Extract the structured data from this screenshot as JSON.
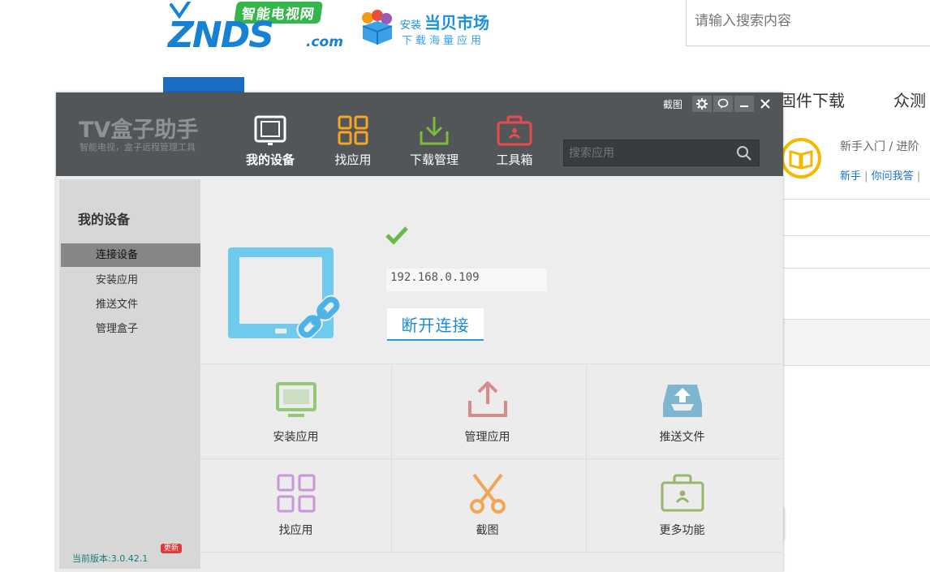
{
  "site": {
    "logo_badge": "智能电视网",
    "logo_main": "ZNDS",
    "logo_com": ".com",
    "market_install": "安装",
    "market_title": "当贝市场",
    "market_sub": "下载海量应用",
    "search_placeholder": "请输入搜索内容",
    "nav": [
      "固件下载",
      "众测"
    ],
    "help_text": "新手入门 / 进阶",
    "help_links": [
      "新手",
      "你问我答"
    ]
  },
  "app": {
    "brand": "TV盒子助手",
    "brand_sub": "智能电视，盒子远程管理工具",
    "screenshot_label": "截图",
    "top_nav": [
      {
        "label": "我的设备",
        "icon": "tv-icon",
        "color": "#ffffff"
      },
      {
        "label": "找应用",
        "icon": "grid-icon",
        "color": "#f5a623"
      },
      {
        "label": "下载管理",
        "icon": "download-icon",
        "color": "#7dbb38"
      },
      {
        "label": "工具箱",
        "icon": "toolbox-icon",
        "color": "#e94b4b"
      }
    ],
    "search_placeholder": "搜索应用",
    "sidebar": {
      "title": "我的设备",
      "items": [
        "连接设备",
        "安装应用",
        "推送文件",
        "管理盒子"
      ],
      "active_index": 0,
      "version": "当前版本:3.0.42.1",
      "update_badge": "更新"
    },
    "device": {
      "ip": "192.168.0.109",
      "disconnect_label": "断开连接",
      "connected": true
    },
    "tiles": [
      {
        "label": "安装应用",
        "icon": "install-tv-icon",
        "color": "#93c87a"
      },
      {
        "label": "管理应用",
        "icon": "upload-tray-icon",
        "color": "#d98b8b"
      },
      {
        "label": "推送文件",
        "icon": "push-box-icon",
        "color": "#7fb6cf"
      },
      {
        "label": "找应用",
        "icon": "grid-icon",
        "color": "#c996d9"
      },
      {
        "label": "截图",
        "icon": "scissors-icon",
        "color": "#f2a555"
      },
      {
        "label": "更多功能",
        "icon": "toolbox-icon",
        "color": "#96b86a"
      }
    ]
  }
}
